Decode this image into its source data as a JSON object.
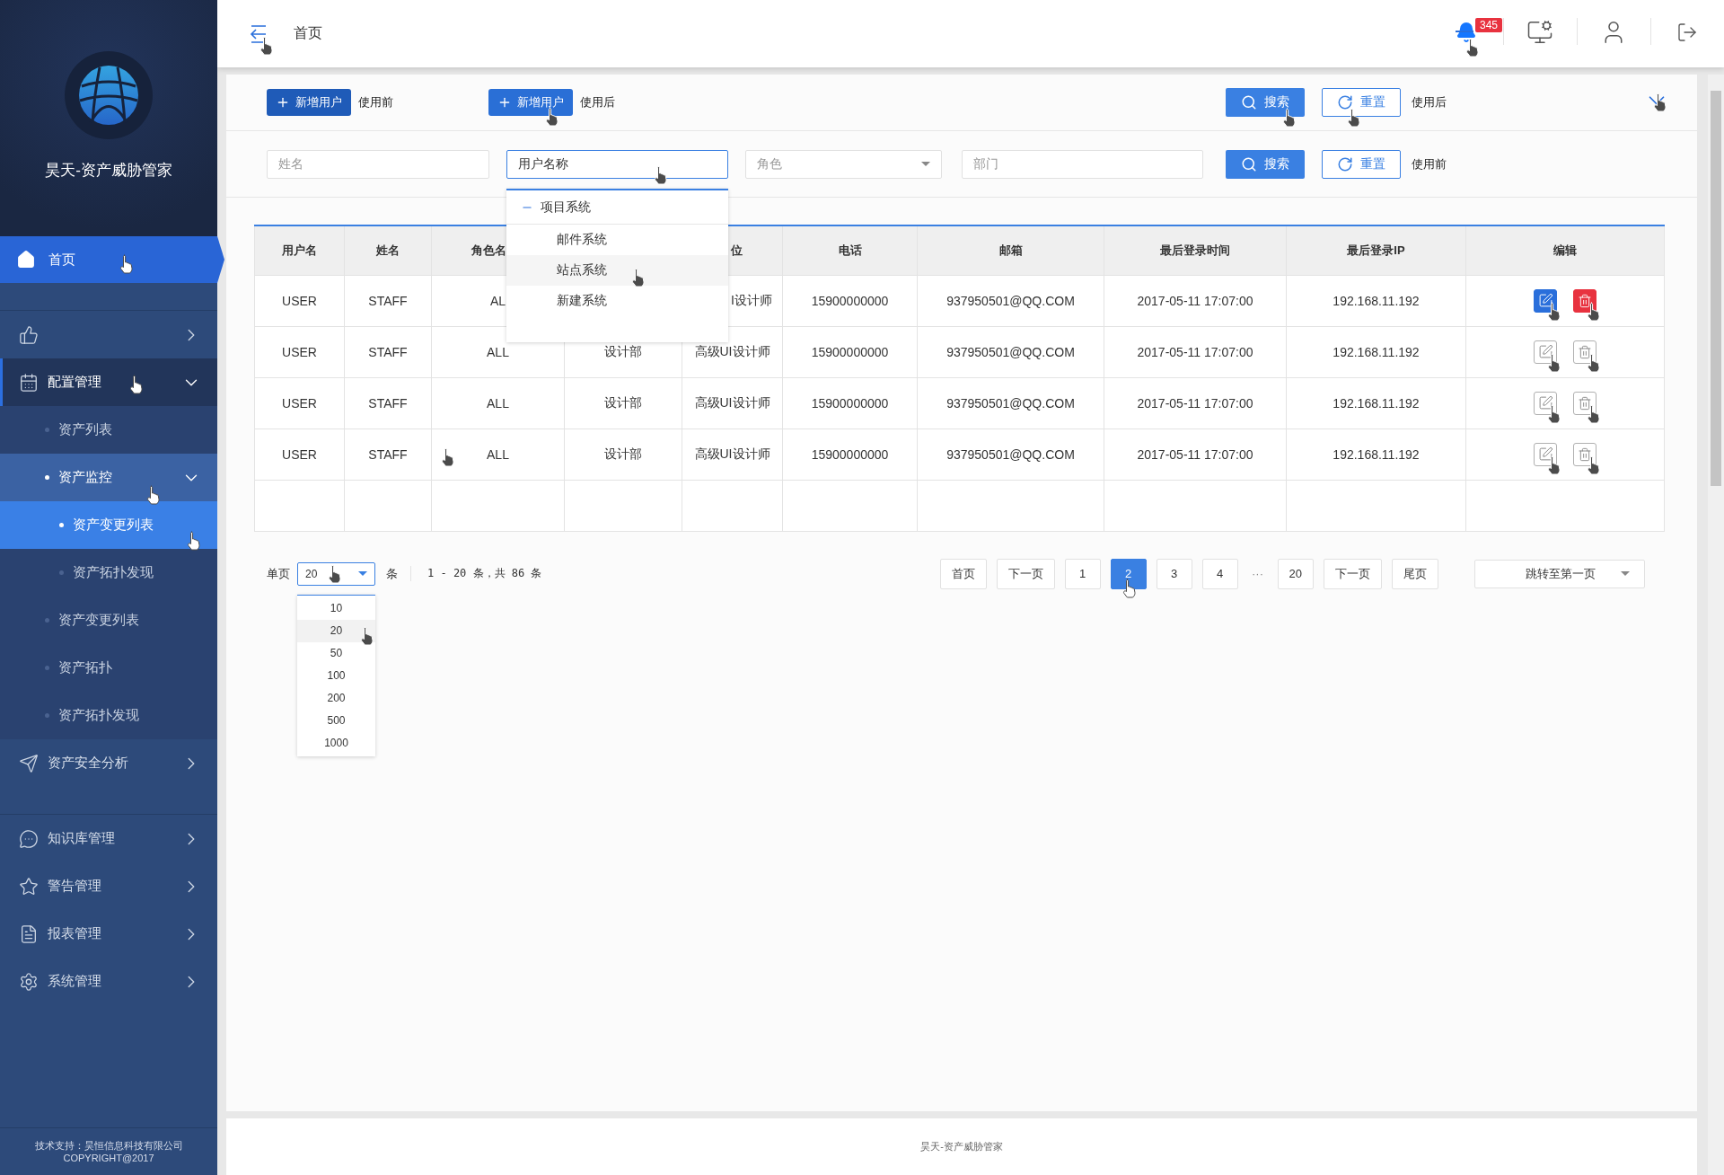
{
  "sidebar": {
    "brand": "昊天-资产威胁管家",
    "sections": [
      {
        "items": [
          {
            "kind": "main",
            "label": "首页",
            "selected": true
          }
        ]
      },
      {
        "items": [
          {
            "kind": "group",
            "expanded": false
          },
          {
            "kind": "group",
            "label": "配置管理",
            "expanded": true,
            "children": [
              {
                "label": "资产列表",
                "selected": false
              },
              {
                "label": "资产监控",
                "selected": false,
                "expanded": true,
                "children": [
                  {
                    "label": "资产变更列表",
                    "selected": true
                  },
                  {
                    "label": "资产拓扑发现",
                    "selected": false
                  }
                ]
              },
              {
                "label": "资产变更列表",
                "selected": false
              },
              {
                "label": "资产拓扑",
                "selected": false
              },
              {
                "label": "资产拓扑发现",
                "selected": false
              }
            ]
          },
          {
            "kind": "group",
            "label": "资产安全分析",
            "expanded": false
          }
        ]
      },
      {
        "items": [
          {
            "kind": "group",
            "label": "知识库管理",
            "expanded": false
          },
          {
            "kind": "group",
            "label": "警告管理",
            "expanded": false
          },
          {
            "kind": "group",
            "label": "报表管理",
            "expanded": false
          },
          {
            "kind": "group",
            "label": "系统管理",
            "expanded": false
          }
        ]
      }
    ],
    "footer": [
      "技术支持：昊恒信息科技有限公司",
      "COPYRIGHT@2017"
    ]
  },
  "topbar": {
    "title": "首页",
    "notifications": "345"
  },
  "add_buttons": [
    {
      "label": "新增用户",
      "note": "使用前"
    },
    {
      "label": "新增用户",
      "note": "使用后"
    }
  ],
  "top_actions": {
    "search": "搜索",
    "reset": "重置",
    "note": "使用后"
  },
  "filters": [
    {
      "kind": "text",
      "placeholder": "姓名",
      "focused": false
    },
    {
      "kind": "text",
      "value": "用户名称",
      "focused": true
    },
    {
      "kind": "select",
      "placeholder": "角色",
      "focused": false
    },
    {
      "kind": "text",
      "placeholder": "部门",
      "focused": false
    }
  ],
  "filter_actions": {
    "search": "搜索",
    "reset": "重置",
    "note": "使用前"
  },
  "tree_dropdown": {
    "group": "项目系统",
    "expanded": true,
    "options": [
      {
        "label": "邮件系统",
        "selected": false
      },
      {
        "label": "站点系统",
        "selected": true
      },
      {
        "label": "新建系统",
        "selected": false
      }
    ]
  },
  "table": {
    "columns": [
      "用户名",
      "姓名",
      "角色名",
      null,
      "位",
      "电话",
      "邮箱",
      "最后登录时间",
      "最后登录IP",
      "编辑"
    ],
    "rows": [
      {
        "active": true,
        "cells": [
          "USER",
          "STAFF",
          "AL",
          null,
          "I设计师",
          "15900000000",
          "937950501@QQ.COM",
          "2017-05-11 17:07:00",
          "192.168.11.192"
        ]
      },
      {
        "active": false,
        "cells": [
          "USER",
          "STAFF",
          "ALL",
          "设计部",
          "高级UI设计师",
          "15900000000",
          "937950501@QQ.COM",
          "2017-05-11 17:07:00",
          "192.168.11.192"
        ]
      },
      {
        "active": false,
        "cells": [
          "USER",
          "STAFF",
          "ALL",
          "设计部",
          "高级UI设计师",
          "15900000000",
          "937950501@QQ.COM",
          "2017-05-11 17:07:00",
          "192.168.11.192"
        ]
      },
      {
        "active": false,
        "cells": [
          "USER",
          "STAFF",
          "ALL",
          "设计部",
          "高级UI设计师",
          "15900000000",
          "937950501@QQ.COM",
          "2017-05-11 17:07:00",
          "192.168.11.192"
        ]
      }
    ]
  },
  "pagination": {
    "per_page_label": "单页",
    "per_page": "20",
    "unit": "条",
    "summary": "1 - 20 条，共 86 条",
    "page_size_options": [
      {
        "label": "10",
        "selected": false
      },
      {
        "label": "20",
        "selected": true
      },
      {
        "label": "50",
        "selected": false
      },
      {
        "label": "100",
        "selected": false
      },
      {
        "label": "200",
        "selected": false
      },
      {
        "label": "500",
        "selected": false
      },
      {
        "label": "1000",
        "selected": false
      }
    ],
    "buttons": [
      {
        "kind": "nav",
        "label": "首页"
      },
      {
        "kind": "nav",
        "label": "下一页"
      },
      {
        "kind": "page",
        "label": "1",
        "selected": false
      },
      {
        "kind": "page",
        "label": "2",
        "selected": true
      },
      {
        "kind": "page",
        "label": "3",
        "selected": false
      },
      {
        "kind": "page",
        "label": "4",
        "selected": false
      },
      {
        "kind": "ellipsis",
        "label": "···"
      },
      {
        "kind": "page",
        "label": "20",
        "selected": false
      },
      {
        "kind": "nav",
        "label": "下一页"
      },
      {
        "kind": "nav",
        "label": "尾页"
      }
    ],
    "jump": "跳转至第一页"
  },
  "footer": "昊天-资产威胁管家"
}
